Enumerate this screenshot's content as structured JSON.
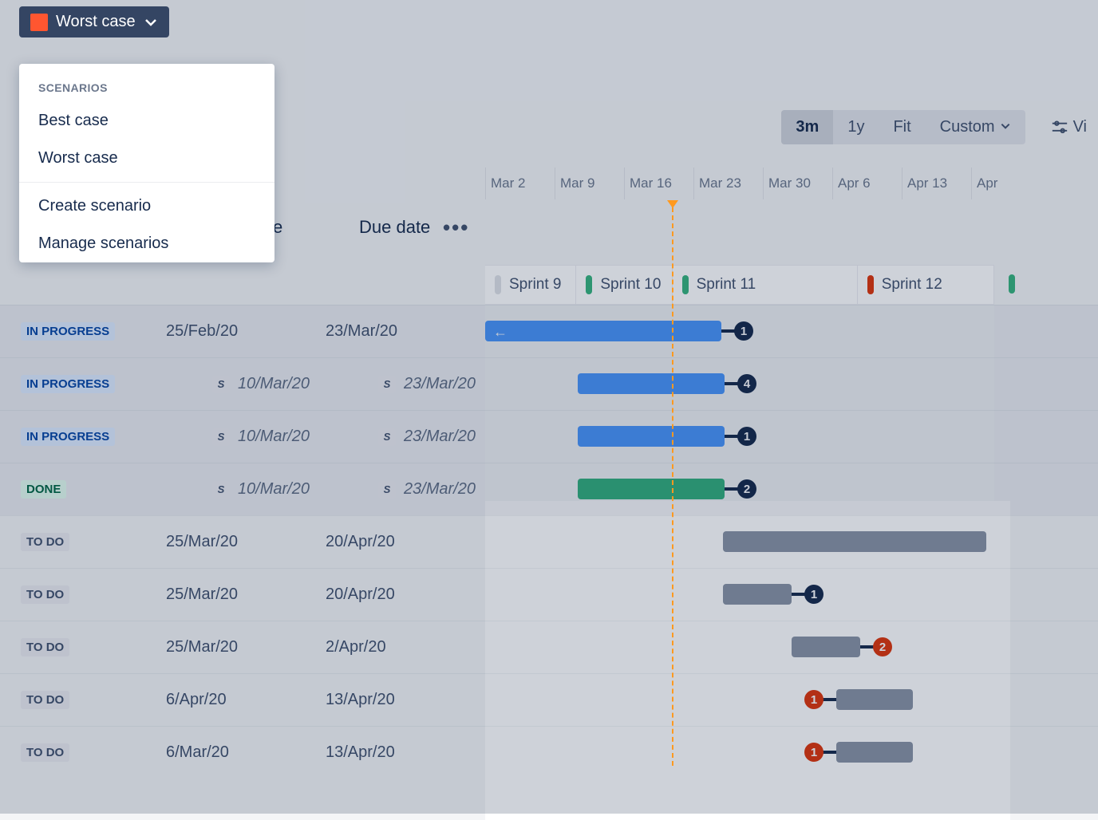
{
  "scenario_selector": {
    "current": "Worst case",
    "color": "#ff5630"
  },
  "dropdown": {
    "header": "SCENARIOS",
    "items": [
      "Best case",
      "Worst case"
    ],
    "actions": [
      "Create scenario",
      "Manage scenarios"
    ]
  },
  "range": {
    "options": [
      "3m",
      "1y",
      "Fit",
      "Custom"
    ],
    "active": "3m",
    "view_label": "Vi"
  },
  "columns": {
    "target_suffix": "e",
    "due": "Due date"
  },
  "timeline_weeks": [
    "Mar 2",
    "Mar 9",
    "Mar 16",
    "Mar 23",
    "Mar 30",
    "Apr 6",
    "Apr 13",
    "Apr"
  ],
  "sprints": [
    {
      "label": "Sprint 9",
      "color": "#dfe1e6"
    },
    {
      "label": "Sprint 10",
      "color": "#36b37e"
    },
    {
      "label": "Sprint 11",
      "color": "#36b37e"
    },
    {
      "label": "Sprint 12",
      "color": "#de350b"
    }
  ],
  "rows": [
    {
      "status": "IN PROGRESS",
      "status_class": "st-inprogress",
      "target": "25/Feb/20",
      "due": "23/Mar/20",
      "sprint": false,
      "italic": false
    },
    {
      "status": "IN PROGRESS",
      "status_class": "st-inprogress",
      "target": "10/Mar/20",
      "due": "23/Mar/20",
      "sprint": true,
      "italic": true
    },
    {
      "status": "IN PROGRESS",
      "status_class": "st-inprogress",
      "target": "10/Mar/20",
      "due": "23/Mar/20",
      "sprint": true,
      "italic": true
    },
    {
      "status": "DONE",
      "status_class": "st-done",
      "target": "10/Mar/20",
      "due": "23/Mar/20",
      "sprint": true,
      "italic": true
    },
    {
      "status": "TO DO",
      "status_class": "st-todo",
      "target": "25/Mar/20",
      "due": "20/Apr/20",
      "sprint": false,
      "italic": false
    },
    {
      "status": "TO DO",
      "status_class": "st-todo",
      "target": "25/Mar/20",
      "due": "20/Apr/20",
      "sprint": false,
      "italic": false
    },
    {
      "status": "TO DO",
      "status_class": "st-todo",
      "target": "25/Mar/20",
      "due": "2/Apr/20",
      "sprint": false,
      "italic": false
    },
    {
      "status": "TO DO",
      "status_class": "st-todo",
      "target": "6/Apr/20",
      "due": "13/Apr/20",
      "sprint": false,
      "italic": false
    },
    {
      "status": "TO DO",
      "status_class": "st-todo",
      "target": "6/Mar/20",
      "due": "13/Apr/20",
      "sprint": false,
      "italic": false
    }
  ],
  "bars": [
    {
      "row": 0,
      "start": 0,
      "end": 296,
      "color": "bar-blue",
      "arrow": true,
      "badge": "1",
      "badge_color": "badge-navy",
      "badge_side": "right"
    },
    {
      "row": 1,
      "start": 116,
      "end": 300,
      "color": "bar-blue",
      "badge": "4",
      "badge_color": "badge-navy",
      "badge_side": "right"
    },
    {
      "row": 2,
      "start": 116,
      "end": 300,
      "color": "bar-blue",
      "badge": "1",
      "badge_color": "badge-navy",
      "badge_side": "right"
    },
    {
      "row": 3,
      "start": 116,
      "end": 300,
      "color": "bar-green",
      "badge": "2",
      "badge_color": "badge-navy",
      "badge_side": "right"
    },
    {
      "row": 4,
      "start": 298,
      "end": 628,
      "color": "bar-grey"
    },
    {
      "row": 5,
      "start": 298,
      "end": 384,
      "color": "bar-grey",
      "badge": "1",
      "badge_color": "badge-navy",
      "badge_side": "right"
    },
    {
      "row": 6,
      "start": 384,
      "end": 470,
      "color": "bar-grey",
      "badge": "2",
      "badge_color": "badge-red",
      "badge_side": "right"
    },
    {
      "row": 7,
      "start": 440,
      "end": 536,
      "color": "bar-grey",
      "badge": "1",
      "badge_color": "badge-red",
      "badge_side": "left"
    },
    {
      "row": 8,
      "start": 440,
      "end": 536,
      "color": "bar-grey",
      "badge": "1",
      "badge_color": "badge-red",
      "badge_side": "left"
    }
  ]
}
